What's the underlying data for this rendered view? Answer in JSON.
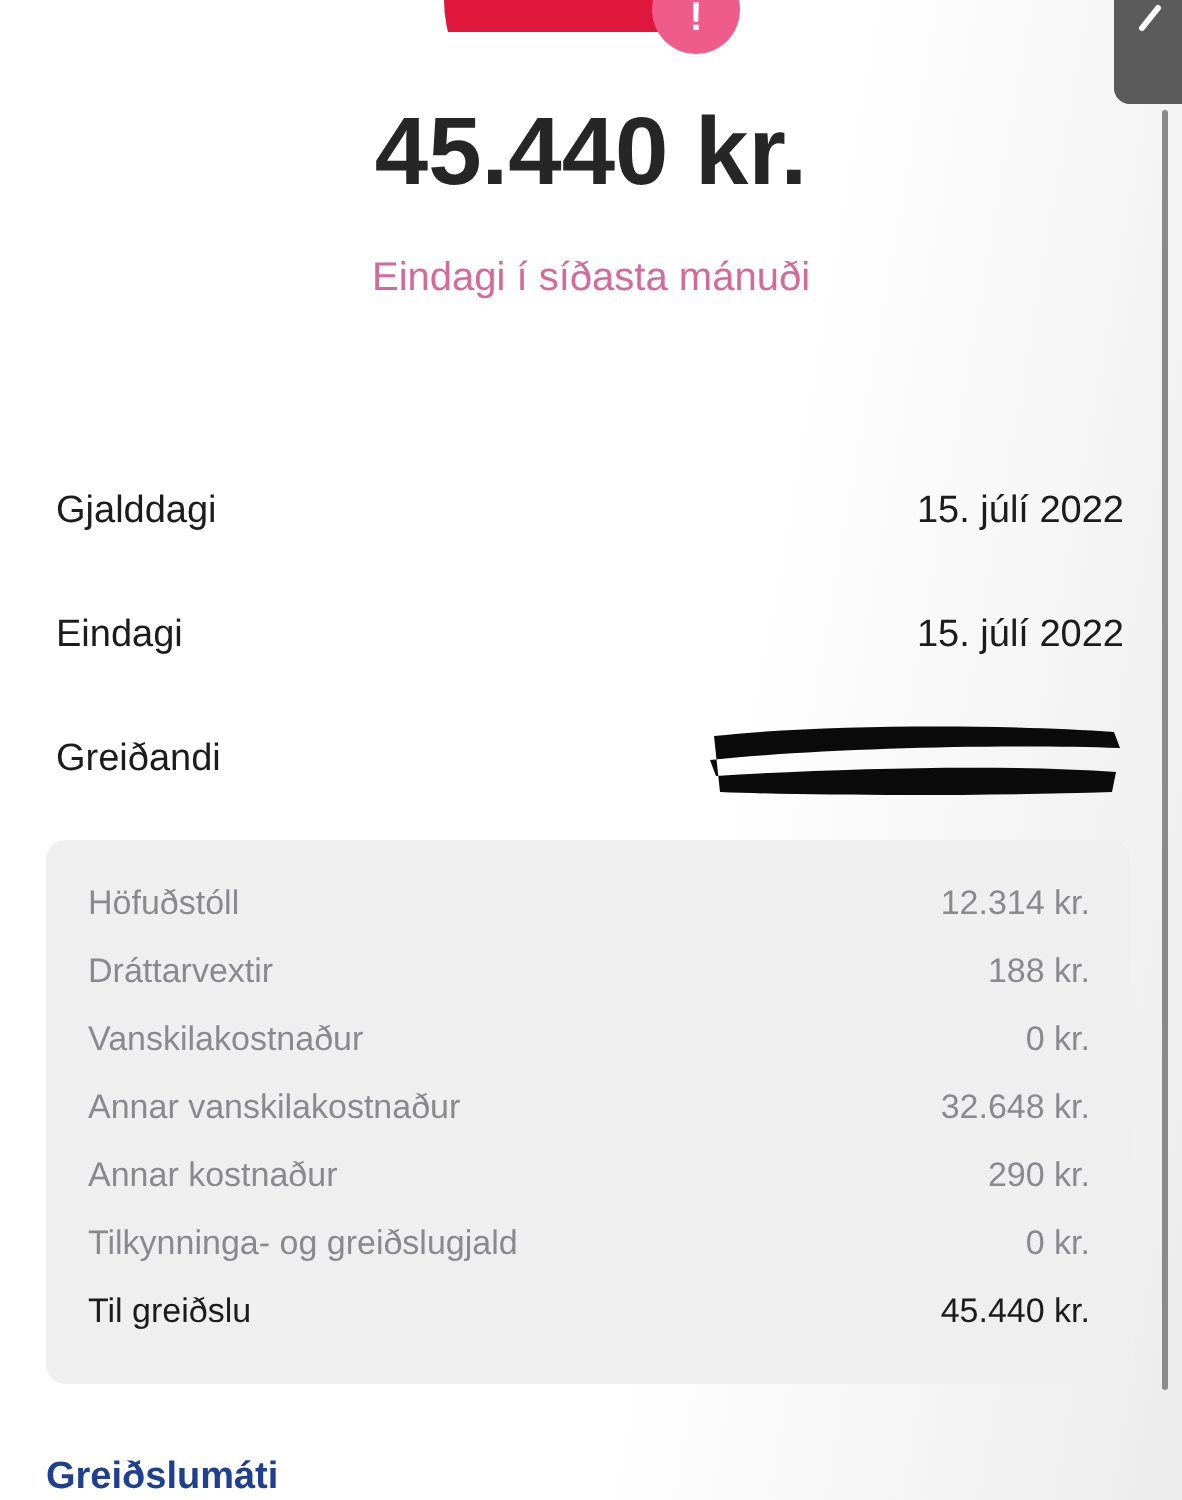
{
  "header": {
    "badge": "!",
    "amount": "45.440 kr.",
    "status": "Eindagi í síðasta mánuði"
  },
  "details": [
    {
      "label": "Gjalddagi",
      "value": "15. júlí 2022"
    },
    {
      "label": "Eindagi",
      "value": "15. júlí 2022"
    },
    {
      "label": "Greiðandi",
      "redacted": true
    }
  ],
  "breakdown": [
    {
      "label": "Höfuðstóll",
      "value": "12.314 kr.",
      "total": false
    },
    {
      "label": "Dráttarvextir",
      "value": "188 kr.",
      "total": false
    },
    {
      "label": "Vanskilakostnaður",
      "value": "0 kr.",
      "total": false
    },
    {
      "label": "Annar vanskilakostnaður",
      "value": "32.648 kr.",
      "total": false
    },
    {
      "label": "Annar kostnaður",
      "value": "290 kr.",
      "total": false
    },
    {
      "label": "Tilkynninga- og greiðslugjald",
      "value": "0 kr.",
      "total": false
    },
    {
      "label": "Til greiðslu",
      "value": "45.440 kr.",
      "total": true
    }
  ],
  "section_link": "Greiðslumáti"
}
